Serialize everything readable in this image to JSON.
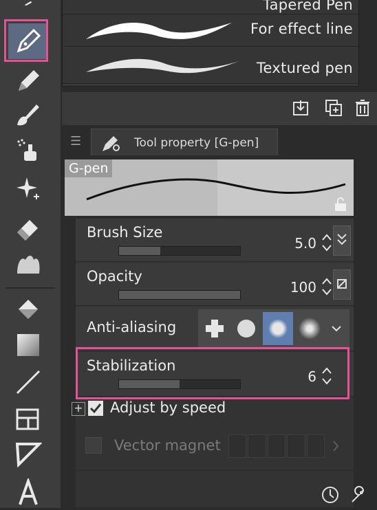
{
  "brush_list": {
    "items": [
      {
        "label": "Tapered Pen"
      },
      {
        "label": "For effect line"
      },
      {
        "label": "Textured pen"
      }
    ]
  },
  "panel": {
    "tab_label": "Tool property [G-pen]",
    "preview_name": "G-pen"
  },
  "properties": {
    "brush_size": {
      "label": "Brush Size",
      "value": "5.0",
      "fill": 0.34
    },
    "opacity": {
      "label": "Opacity",
      "value": "100",
      "fill": 1.0
    },
    "anti_aliasing": {
      "label": "Anti-aliasing",
      "selected_index": 2
    },
    "stabilization": {
      "label": "Stabilization",
      "value": "6",
      "fill": 0.5
    }
  },
  "options": {
    "adjust_by_speed": {
      "label": "Adjust by speed",
      "checked": true
    },
    "vector_magnet": {
      "label": "Vector magnet",
      "enabled": false
    }
  },
  "colors": {
    "highlight": "#e6519a",
    "selected_tool": "#5d6b82",
    "aa_selected": "#5e7fb0"
  }
}
